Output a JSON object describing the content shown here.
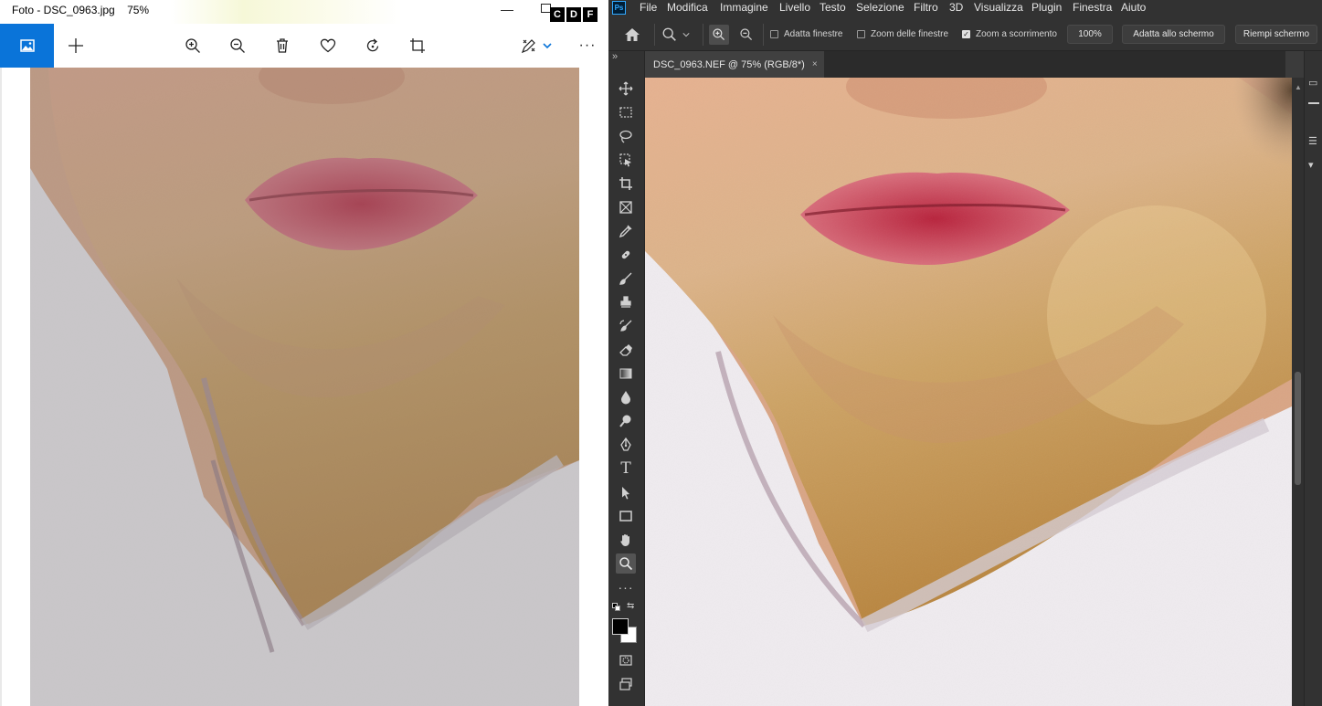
{
  "photos": {
    "title": "Foto - DSC_0963.jpg",
    "zoom": "75%",
    "badges": [
      "C",
      "D",
      "F"
    ],
    "minimize_glyph": "—",
    "toolbar": {
      "gallery_icon": "image-icon",
      "add_icon": "plus-icon",
      "zoom_in_icon": "zoom-in-icon",
      "zoom_out_icon": "zoom-out-icon",
      "delete_icon": "trash-icon",
      "favorite_icon": "heart-icon",
      "rotate_icon": "rotate-icon",
      "crop_icon": "crop-icon",
      "edit_icon": "edit-pen-icon",
      "more_label": "···"
    },
    "accent_color": "#0a74d9"
  },
  "photoshop": {
    "logo": "Ps",
    "menu": [
      "File",
      "Modifica",
      "Immagine",
      "Livello",
      "Testo",
      "Selezione",
      "Filtro",
      "3D",
      "Visualizza",
      "Plugin",
      "Finestra",
      "Aiuto"
    ],
    "options": {
      "checkbox_fit_windows": "Adatta finestre",
      "checkbox_zoom_all": "Zoom delle finestre",
      "checkbox_scrubby": "Zoom a scorrimento",
      "zoom_100": "100%",
      "fit_screen": "Adatta allo schermo",
      "fill_screen": "Riempi schermo"
    },
    "toolbar_collapse": "»",
    "tab": {
      "title": "DSC_0963.NEF @ 75% (RGB/8*)",
      "close": "×"
    },
    "tools": [
      "move-icon",
      "marquee-icon",
      "lasso-icon",
      "object-select-icon",
      "crop-icon",
      "frame-icon",
      "eyedropper-icon",
      "healing-brush-icon",
      "brush-icon",
      "clone-stamp-icon",
      "history-brush-icon",
      "eraser-icon",
      "gradient-icon",
      "blur-icon",
      "dodge-icon",
      "pen-icon",
      "type-icon",
      "path-select-icon",
      "rectangle-icon",
      "hand-icon",
      "zoom-icon",
      "more-tools-icon",
      "quick-mask-icon",
      "screen-mode-icon"
    ],
    "type_tool_label": "T",
    "more_tools_label": "···",
    "foreground_color": "#000000",
    "background_color": "#ffffff"
  }
}
